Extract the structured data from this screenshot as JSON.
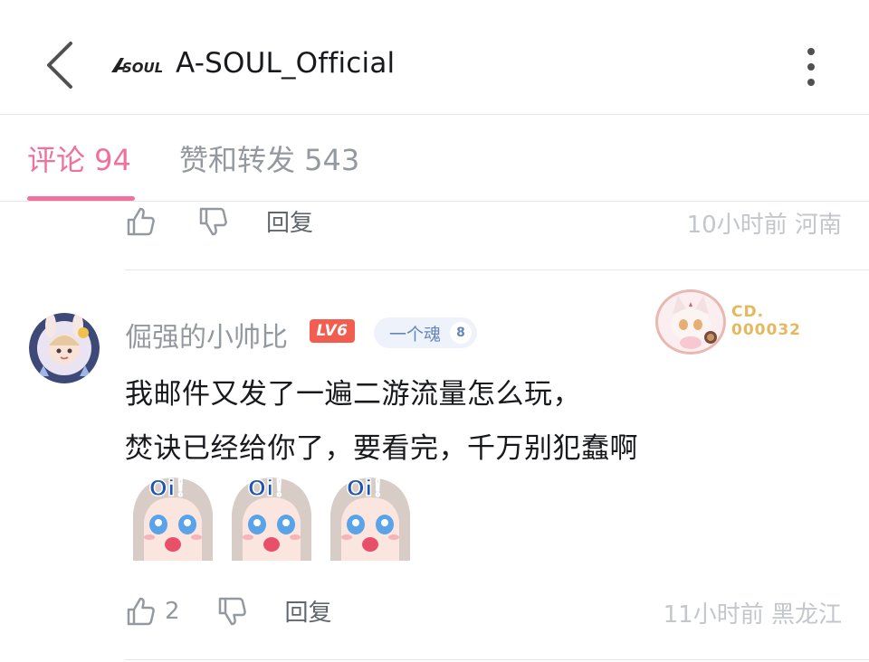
{
  "header": {
    "title": "A-SOUL_Official",
    "logo_text": "ASoul",
    "back_icon": "chevron-left-icon",
    "more_icon": "more-vertical-icon"
  },
  "tabs": {
    "comments": "评论 94",
    "likes_reposts": "赞和转发 543",
    "active_color": "#f0719b"
  },
  "previous_comment": {
    "reply_label": "回复",
    "time": "10小时前",
    "location": "河南"
  },
  "comment": {
    "username": "倔强的小帅比",
    "level": "LV6",
    "fan_medal": {
      "name": "一个魂",
      "level": "8"
    },
    "decoration_card": {
      "line1": "CD.",
      "line2": "000032"
    },
    "lines": [
      "我邮件又发了一遍二游流量怎么玩，",
      "焚诀已经给你了，要看完，千万别犯蠢啊"
    ],
    "sticker_text": "Oi！",
    "like_count": "2",
    "reply_label": "回复",
    "time": "11小时前",
    "location": "黑龙江"
  }
}
